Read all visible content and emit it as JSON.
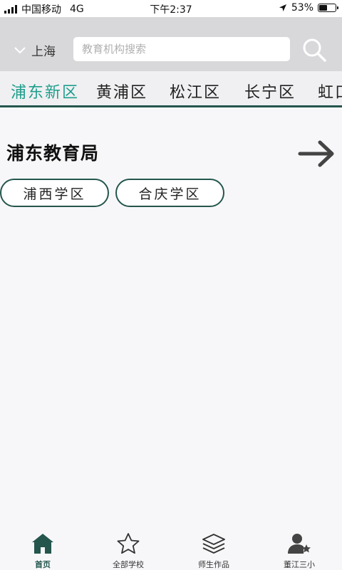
{
  "status_bar": {
    "carrier": "中国移动",
    "network": "4G",
    "time": "下午2:37",
    "battery": "53%",
    "battery_level": 0.53
  },
  "header": {
    "city": "上海",
    "search_placeholder": "教育机构搜索"
  },
  "tabs": [
    {
      "label": "浦东新区",
      "active": true
    },
    {
      "label": "黄浦区",
      "active": false
    },
    {
      "label": "松江区",
      "active": false
    },
    {
      "label": "长宁区",
      "active": false
    },
    {
      "label": "虹口区",
      "active": false
    }
  ],
  "section": {
    "title": "浦东教育局",
    "chips": [
      "浦西学区",
      "合庆学区"
    ]
  },
  "bottom_nav": [
    {
      "label": "首页",
      "icon": "home-icon",
      "active": true
    },
    {
      "label": "全部学校",
      "icon": "star-icon",
      "active": false
    },
    {
      "label": "师生作品",
      "icon": "layers-icon",
      "active": false
    },
    {
      "label": "董江三小",
      "icon": "user-star-icon",
      "active": false
    }
  ],
  "colors": {
    "accent": "#1f9e8c",
    "dark_green": "#24564d",
    "header_bg": "#d8d8da"
  }
}
